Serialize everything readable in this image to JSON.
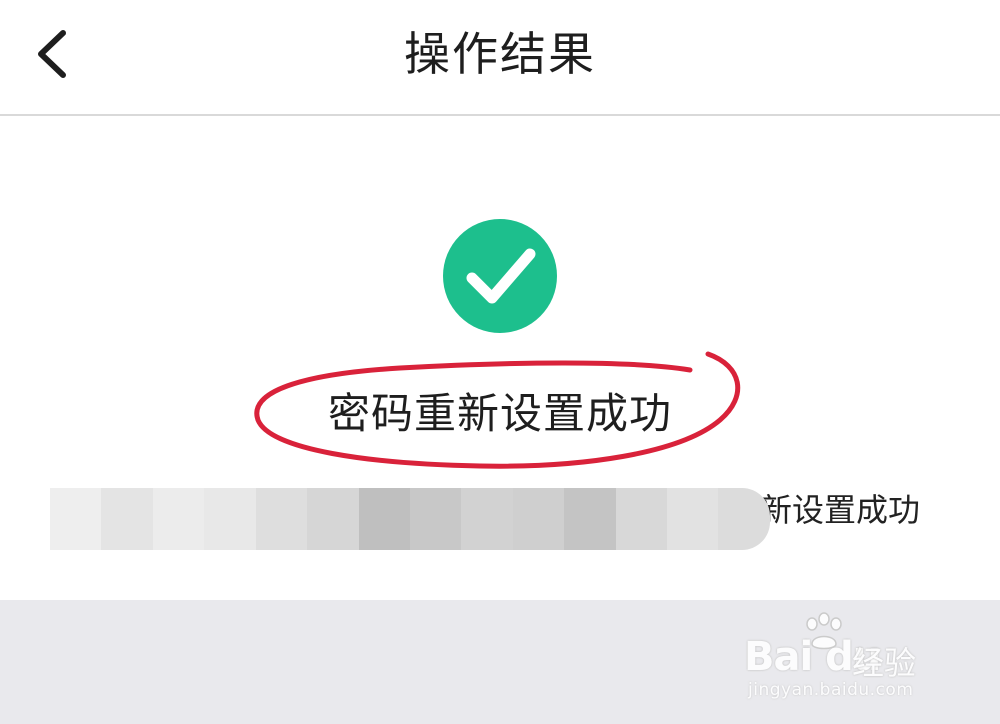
{
  "nav": {
    "title": "操作结果",
    "back_icon": "chevron-left-icon"
  },
  "result": {
    "status_icon": "check-circle-icon",
    "status_color": "#1dbf8d",
    "title": "密码重新设置成功",
    "detail_visible": "新设置成功",
    "highlight_color": "#d9223a"
  },
  "watermark": {
    "brand": "Bai du",
    "product": "经验",
    "url": "jingyan.baidu.com"
  }
}
